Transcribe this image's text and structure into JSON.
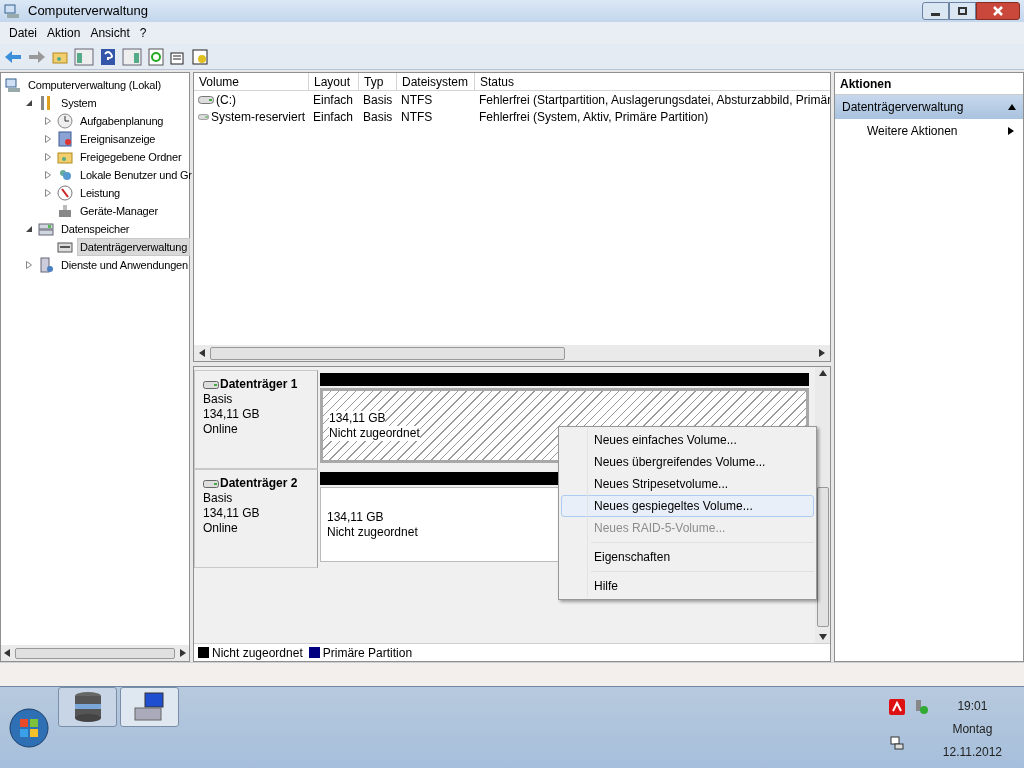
{
  "window": {
    "title": "Computerverwaltung"
  },
  "menu": [
    "Datei",
    "Aktion",
    "Ansicht",
    "?"
  ],
  "tree": [
    {
      "label": "Computerverwaltung (Lokal)",
      "kind": "root",
      "selected": false,
      "children": [
        {
          "label": "System",
          "kind": "branch",
          "expanded": true,
          "selected": false,
          "children": [
            {
              "label": "Aufgabenplanung",
              "kind": "branch",
              "expanded": false,
              "selected": false
            },
            {
              "label": "Ereignisanzeige",
              "kind": "branch",
              "expanded": false,
              "selected": false
            },
            {
              "label": "Freigegebene Ordner",
              "kind": "branch",
              "expanded": false,
              "selected": false
            },
            {
              "label": "Lokale Benutzer und Gr",
              "kind": "branch",
              "expanded": false,
              "selected": false
            },
            {
              "label": "Leistung",
              "kind": "branch",
              "expanded": false,
              "selected": false
            },
            {
              "label": "Geräte-Manager",
              "kind": "leaf",
              "selected": false
            }
          ]
        },
        {
          "label": "Datenspeicher",
          "kind": "branch",
          "expanded": true,
          "selected": false,
          "children": [
            {
              "label": "Datenträgerverwaltung",
              "kind": "leaf",
              "selected": true
            }
          ]
        },
        {
          "label": "Dienste und Anwendungen",
          "kind": "branch",
          "expanded": false,
          "selected": false
        }
      ]
    }
  ],
  "volumes": {
    "columns": [
      "Volume",
      "Layout",
      "Typ",
      "Dateisystem",
      "Status"
    ],
    "rows": [
      [
        "(C:)",
        "Einfach",
        "Basis",
        "NTFS",
        "Fehlerfrei (Startpartition, Auslagerungsdatei, Absturzabbild, Primär"
      ],
      [
        "System-reserviert",
        "Einfach",
        "Basis",
        "NTFS",
        "Fehlerfrei (System, Aktiv, Primäre Partition)"
      ]
    ]
  },
  "disks": [
    {
      "name": "Datenträger 1",
      "type": "Basis",
      "size": "134,11 GB",
      "status": "Online",
      "partition": {
        "size": "134,11 GB",
        "label": "Nicht zugeordnet",
        "selected": true
      }
    },
    {
      "name": "Datenträger 2",
      "type": "Basis",
      "size": "134,11 GB",
      "status": "Online",
      "partition": {
        "size": "134,11 GB",
        "label": "Nicht zugeordnet",
        "selected": false
      }
    }
  ],
  "legend": [
    {
      "label": "Nicht zugeordnet",
      "color": "#000000"
    },
    {
      "label": "Primäre Partition",
      "color": "#000080"
    }
  ],
  "context_menu": [
    {
      "kind": "item",
      "label": "Neues einfaches Volume...",
      "disabled": false,
      "selected": false
    },
    {
      "kind": "item",
      "label": "Neues übergreifendes Volume...",
      "disabled": false,
      "selected": false
    },
    {
      "kind": "item",
      "label": "Neues Stripesetvolume...",
      "disabled": false,
      "selected": false
    },
    {
      "kind": "item",
      "label": "Neues gespiegeltes Volume...",
      "disabled": false,
      "selected": true
    },
    {
      "kind": "item",
      "label": "Neues RAID-5-Volume...",
      "disabled": true,
      "selected": false
    },
    {
      "kind": "separator"
    },
    {
      "kind": "item",
      "label": "Eigenschaften",
      "disabled": false,
      "selected": false
    },
    {
      "kind": "separator"
    },
    {
      "kind": "item",
      "label": "Hilfe",
      "disabled": false,
      "selected": false
    }
  ],
  "actions": {
    "title": "Aktionen",
    "section": {
      "label": "Datenträgerverwaltung",
      "expanded": true
    },
    "items": [
      "Weitere Aktionen"
    ]
  },
  "clock": {
    "time": "19:01",
    "day": "Montag",
    "date": "12.11.2012"
  }
}
